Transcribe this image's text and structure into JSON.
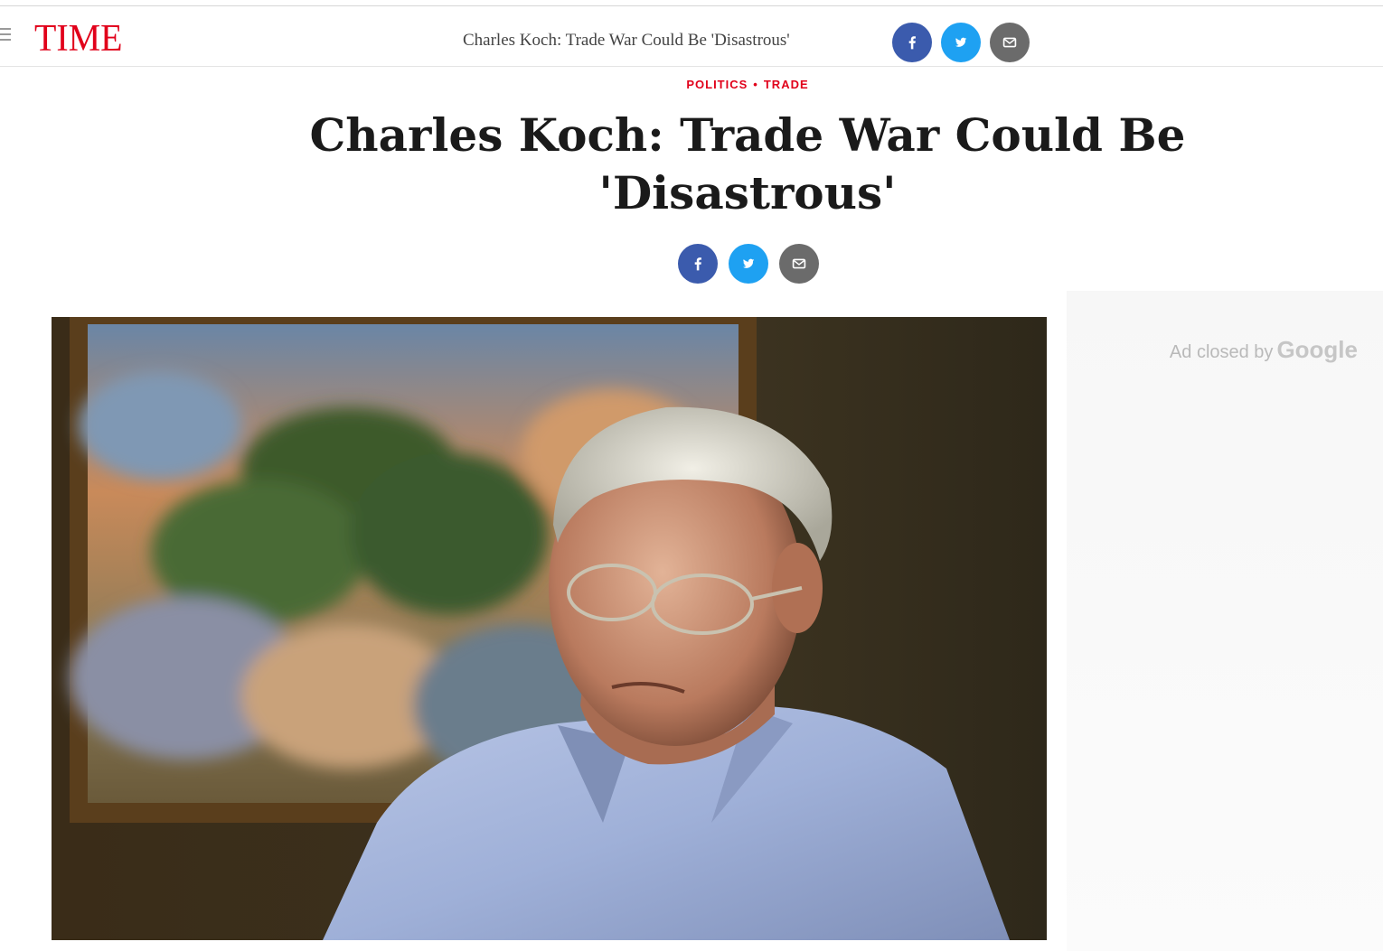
{
  "site": {
    "logo": "TIME",
    "brand_color": "#e1001a"
  },
  "topbar": {
    "title": "Charles Koch: Trade War Could Be 'Disastrous'",
    "share": [
      {
        "icon": "facebook-icon",
        "color": "#3b5bad"
      },
      {
        "icon": "twitter-icon",
        "color": "#1ea1f2"
      },
      {
        "icon": "email-icon",
        "color": "#6b6b6b"
      }
    ]
  },
  "article": {
    "category_1": "POLITICS",
    "category_sep": "•",
    "category_2": "TRADE",
    "headline": "Charles Koch: Trade War Could Be 'Disastrous'"
  },
  "ad": {
    "label": "Ad closed by",
    "brand": "Google"
  }
}
